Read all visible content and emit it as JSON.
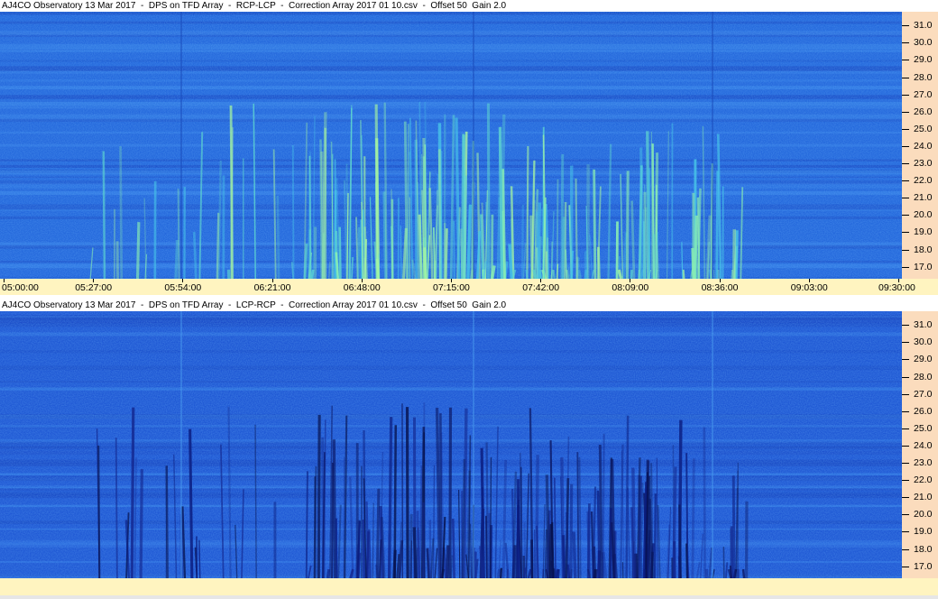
{
  "panels": [
    {
      "title": "AJ4CO Observatory 13 Mar 2017  -  DPS on TFD Array  -  RCP-LCP  -  Correction Array 2017 01 10.csv  -  Offset 50  Gain 2.0",
      "polarity": "RCP-LCP"
    },
    {
      "title": "AJ4CO Observatory 13 Mar 2017  -  DPS on TFD Array  -  LCP-RCP  -  Correction Array 2017 01 10.csv  -  Offset 50  Gain 2.0",
      "polarity": "LCP-RCP"
    }
  ],
  "colors": {
    "background_blue": "#1f5fd6",
    "bright_emission": "#7ff0c0",
    "dark_emission": "#0a1a70",
    "yaxis_bg": "#fbdcbd",
    "xaxis_bg": "#fff4c0"
  },
  "chart_data": [
    {
      "type": "heatmap",
      "title": "AJ4CO Observatory 13 Mar 2017  -  DPS on TFD Array  -  RCP-LCP  -  Correction Array 2017 01 10.csv  -  Offset 50  Gain 2.0",
      "x_ticks": [
        "05:00:00",
        "05:27:00",
        "05:54:00",
        "06:21:00",
        "06:48:00",
        "07:15:00",
        "07:42:00",
        "08:09:00",
        "08:36:00",
        "09:03:00",
        "09:30:00"
      ],
      "y_ticks": [
        "31.0",
        "30.0",
        "29.0",
        "28.0",
        "27.0",
        "26.0",
        "25.0",
        "24.0",
        "23.0",
        "22.0",
        "21.0",
        "20.0",
        "19.0",
        "18.0",
        "17.0"
      ],
      "x_range": [
        "05:00:00",
        "09:30:00"
      ],
      "y_range": [
        16.3,
        31.8
      ]
    },
    {
      "type": "heatmap",
      "title": "AJ4CO Observatory 13 Mar 2017  -  DPS on TFD Array  -  LCP-RCP  -  Correction Array 2017 01 10.csv  -  Offset 50  Gain 2.0",
      "y_ticks": [
        "31.0",
        "30.0",
        "29.0",
        "28.0",
        "27.0",
        "26.0",
        "25.0",
        "24.0",
        "23.0",
        "22.0",
        "21.0",
        "20.0",
        "19.0",
        "18.0",
        "17.0"
      ],
      "y_range": [
        16.3,
        31.8
      ]
    }
  ]
}
